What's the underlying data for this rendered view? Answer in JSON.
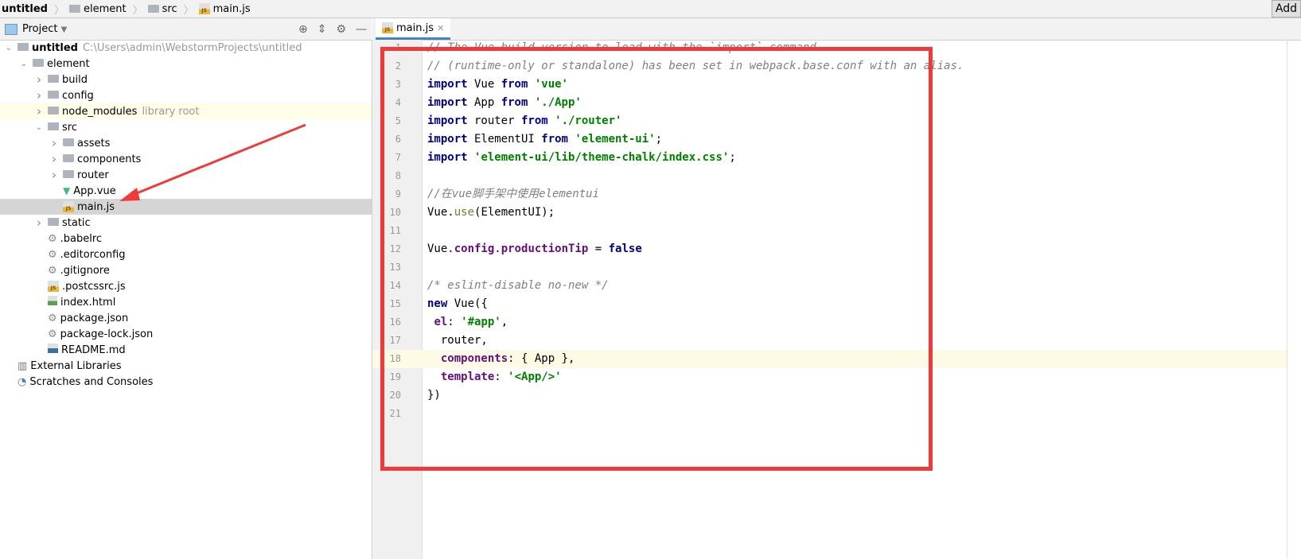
{
  "breadcrumb": [
    "untitled",
    "element",
    "src",
    "main.js"
  ],
  "add_button": "Add",
  "sidebar": {
    "title": "Project",
    "rows": [
      {
        "label": "untitled",
        "hint": "C:\\Users\\admin\\WebstormProjects\\untitled",
        "depth": 0,
        "arrow": "open",
        "icon": "folder-icon",
        "bold": true
      },
      {
        "label": "element",
        "depth": 1,
        "arrow": "open",
        "icon": "folder-icon"
      },
      {
        "label": "build",
        "depth": 2,
        "arrow": "closed",
        "icon": "folder-icon"
      },
      {
        "label": "config",
        "depth": 2,
        "arrow": "closed",
        "icon": "folder-icon"
      },
      {
        "label": "node_modules",
        "hint": "library root",
        "depth": 2,
        "arrow": "closed",
        "icon": "folder-icon",
        "bg": "#fdfde8"
      },
      {
        "label": "src",
        "depth": 2,
        "arrow": "open",
        "icon": "folder-icon"
      },
      {
        "label": "assets",
        "depth": 3,
        "arrow": "closed",
        "icon": "folder-icon"
      },
      {
        "label": "components",
        "depth": 3,
        "arrow": "closed",
        "icon": "folder-icon"
      },
      {
        "label": "router",
        "depth": 3,
        "arrow": "closed",
        "icon": "folder-icon"
      },
      {
        "label": "App.vue",
        "depth": 3,
        "arrow": "",
        "icon": "vue-icon"
      },
      {
        "label": "main.js",
        "depth": 3,
        "arrow": "",
        "icon": "js-file-icon",
        "bg": "#d5d5d5"
      },
      {
        "label": "static",
        "depth": 2,
        "arrow": "closed",
        "icon": "folder-icon"
      },
      {
        "label": ".babelrc",
        "depth": 2,
        "arrow": "",
        "icon": "config-file-icon"
      },
      {
        "label": ".editorconfig",
        "depth": 2,
        "arrow": "",
        "icon": "gear-file-icon"
      },
      {
        "label": ".gitignore",
        "depth": 2,
        "arrow": "",
        "icon": "config-file-icon"
      },
      {
        "label": ".postcssrc.js",
        "depth": 2,
        "arrow": "",
        "icon": "js-file-icon"
      },
      {
        "label": "index.html",
        "depth": 2,
        "arrow": "",
        "icon": "html-file-icon"
      },
      {
        "label": "package.json",
        "depth": 2,
        "arrow": "",
        "icon": "config-file-icon"
      },
      {
        "label": "package-lock.json",
        "depth": 2,
        "arrow": "",
        "icon": "config-file-icon"
      },
      {
        "label": "README.md",
        "depth": 2,
        "arrow": "",
        "icon": "md-file-icon"
      },
      {
        "label": "External Libraries",
        "depth": 0,
        "arrow": "",
        "icon": "library-icon"
      },
      {
        "label": "Scratches and Consoles",
        "depth": 0,
        "arrow": "",
        "icon": "scratch-icon"
      }
    ]
  },
  "editor": {
    "tab": "main.js",
    "current_line": 18,
    "lines": [
      [
        [
          "cm",
          "// The Vue build version to load with the `import` command"
        ]
      ],
      [
        [
          "cm",
          "// (runtime-only or standalone) has been set in webpack.base.conf with an alias."
        ]
      ],
      [
        [
          "kw",
          "import"
        ],
        [
          "",
          "Vue "
        ],
        [
          "kw",
          "from"
        ],
        [
          "",
          " "
        ],
        [
          "st",
          "'vue'"
        ]
      ],
      [
        [
          "kw",
          "import"
        ],
        [
          "",
          "App "
        ],
        [
          "kw",
          "from"
        ],
        [
          "",
          " "
        ],
        [
          "st",
          "'./App'"
        ]
      ],
      [
        [
          "kw",
          "import"
        ],
        [
          "",
          "router "
        ],
        [
          "kw",
          "from"
        ],
        [
          "",
          " "
        ],
        [
          "st",
          "'./router'"
        ]
      ],
      [
        [
          "kw",
          "import"
        ],
        [
          "",
          "ElementUI "
        ],
        [
          "kw",
          "from"
        ],
        [
          "",
          " "
        ],
        [
          "st",
          "'element-ui'"
        ],
        [
          "",
          ";"
        ]
      ],
      [
        [
          "kw",
          "import"
        ],
        [
          "",
          " "
        ],
        [
          "st",
          "'element-ui/lib/theme-chalk/index.css'"
        ],
        [
          "",
          ";"
        ]
      ],
      [],
      [
        [
          "cm",
          "//在vue脚手架中使用elementui"
        ]
      ],
      [
        [
          "",
          "Vue."
        ],
        [
          "fn",
          "use"
        ],
        [
          "",
          "(ElementUI);"
        ]
      ],
      [],
      [
        [
          "",
          "Vue."
        ],
        [
          "pr",
          "config"
        ],
        [
          "",
          "."
        ],
        [
          "pr",
          "productionTip"
        ],
        [
          "",
          " = "
        ],
        [
          "kw",
          "false"
        ]
      ],
      [],
      [
        [
          "cm",
          "/* eslint-disable no-new */"
        ]
      ],
      [
        [
          "kw",
          "new"
        ],
        [
          "",
          " Vue({"
        ]
      ],
      [
        [
          "",
          " "
        ],
        [
          "pr",
          "el"
        ],
        [
          "",
          ": "
        ],
        [
          "st",
          "'#app'"
        ],
        [
          "",
          ","
        ]
      ],
      [
        [
          "",
          "  router,"
        ]
      ],
      [
        [
          "",
          "  "
        ],
        [
          "pr",
          "components"
        ],
        [
          "",
          ": { App },"
        ]
      ],
      [
        [
          "",
          "  "
        ],
        [
          "pr",
          "template"
        ],
        [
          "",
          ": "
        ],
        [
          "st",
          "'<App/>'"
        ]
      ],
      [
        [
          "",
          "})"
        ]
      ],
      []
    ]
  },
  "annotation_color": "#f03a3a"
}
